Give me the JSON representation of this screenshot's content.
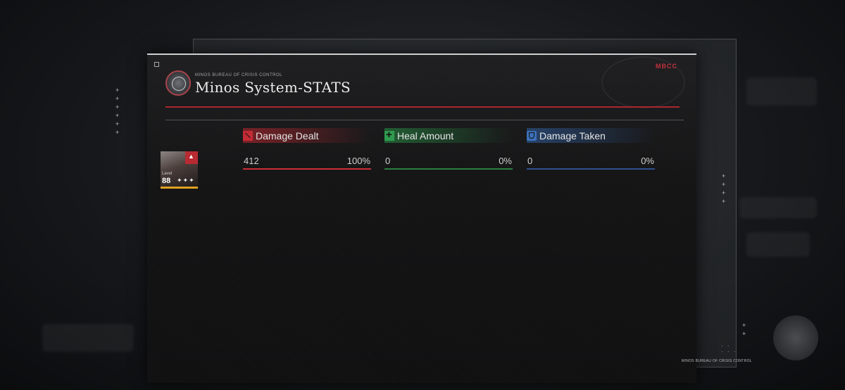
{
  "header": {
    "org_small": "MINOS BUREAU OF CRISIS CONTROL",
    "title": "Minos System-STATS",
    "brand_tag": "MBCC"
  },
  "character": {
    "level_word": "Level",
    "level": "88",
    "stars": "✦✦✦",
    "frame_color": "#e0a020"
  },
  "stats": [
    {
      "label": "Damage Dealt",
      "value": "412",
      "percent": "100%",
      "percent_value": 1.0,
      "color": "#cc2c36",
      "icon": "sword-icon"
    },
    {
      "label": "Heal Amount",
      "value": "0",
      "percent": "0%",
      "percent_value": 0.0,
      "color": "#2e9b4e",
      "icon": "heal-plus-icon"
    },
    {
      "label": "Damage Taken",
      "value": "0",
      "percent": "0%",
      "percent_value": 0.0,
      "color": "#3a6fb8",
      "icon": "shield-icon"
    }
  ],
  "footer": {
    "org": "MINOS BUREAU OF CRISIS CONTROL"
  }
}
